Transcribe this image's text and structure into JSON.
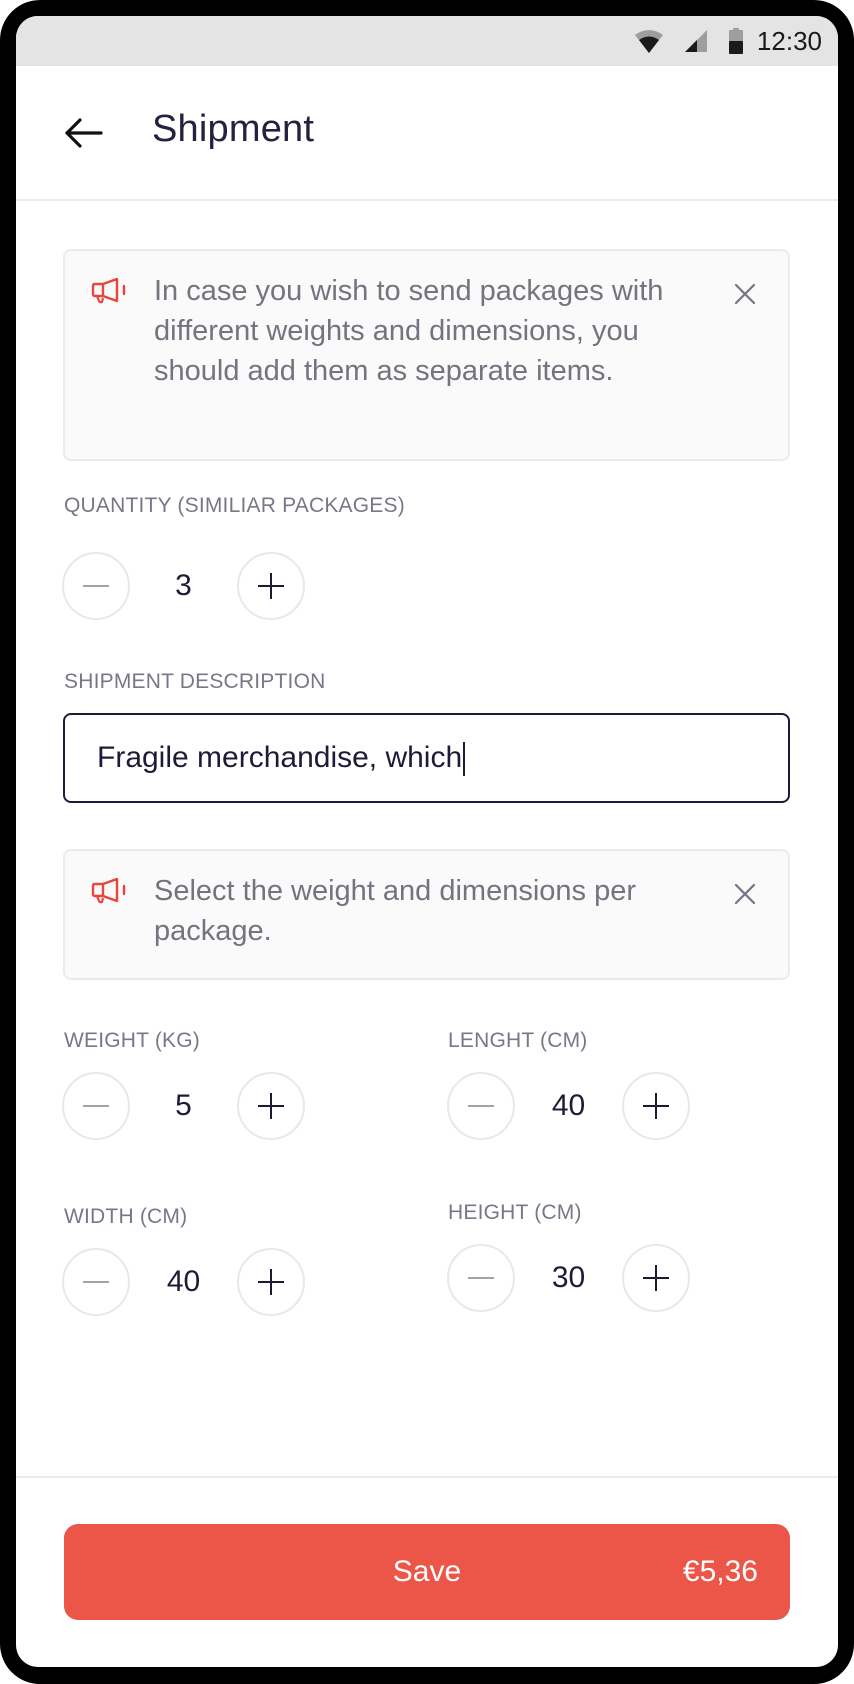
{
  "status_bar": {
    "time": "12:30",
    "icons": [
      "wifi-icon",
      "cellular-signal-icon",
      "battery-icon"
    ]
  },
  "header": {
    "back_icon": "arrow-left-icon",
    "title": "Shipment"
  },
  "notices": [
    {
      "icon": "megaphone-icon",
      "text": "In case you wish to send packages with different weights and dimensions, you should add them as separate items.",
      "close_icon": "close-icon"
    },
    {
      "icon": "megaphone-icon",
      "text": "Select the weight and dimensions per package.",
      "close_icon": "close-icon"
    }
  ],
  "quantity": {
    "label": "QUANTITY (SIMILIAR PACKAGES)",
    "value": "3"
  },
  "description": {
    "label": "SHIPMENT DESCRIPTION",
    "value": "Fragile merchandise, which"
  },
  "dimensions": {
    "weight": {
      "label": "WEIGHT (KG)",
      "value": "5"
    },
    "length": {
      "label": "LENGHT (CM)",
      "value": "40"
    },
    "width": {
      "label": "WIDTH (CM)",
      "value": "40"
    },
    "height": {
      "label": "HEIGHT (CM)",
      "value": "30"
    }
  },
  "footer": {
    "save_label": "Save",
    "price": "€5,36"
  },
  "colors": {
    "accent": "#eb5649",
    "title": "#23223f",
    "label": "#787787",
    "notice_text": "#74737f"
  }
}
